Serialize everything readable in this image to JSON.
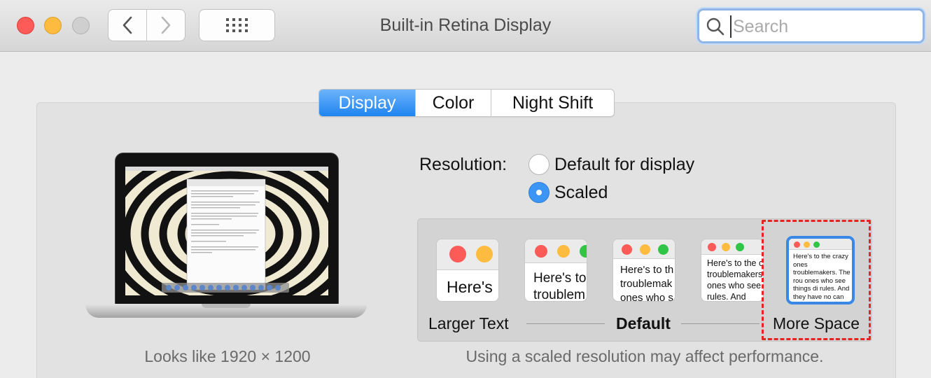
{
  "window": {
    "title": "Built-in Retina Display",
    "traffic_lights": [
      "close",
      "minimize",
      "zoom"
    ]
  },
  "toolbar": {
    "back_icon": "chevron-left-icon",
    "forward_icon": "chevron-right-icon",
    "show_all_icon": "grid-icon",
    "search": {
      "placeholder": "Search",
      "value": ""
    }
  },
  "tabs": [
    {
      "label": "Display",
      "selected": true
    },
    {
      "label": "Color",
      "selected": false
    },
    {
      "label": "Night Shift",
      "selected": false
    }
  ],
  "preview": {
    "looks_like": "Looks like 1920 × 1200"
  },
  "resolution": {
    "label": "Resolution:",
    "options": [
      {
        "label": "Default for display",
        "selected": false
      },
      {
        "label": "Scaled",
        "selected": true
      }
    ]
  },
  "scaled": {
    "sample_text": "Here's to the crazy ones troublemakers. The round ones who see things di rules. And they have no can quote them, disagr them. About the only th Because they change th",
    "thumbnails": [
      {
        "text": "Here's",
        "selected": false
      },
      {
        "text": "Here's to troublem",
        "selected": false
      },
      {
        "text": "Here's to th troublemak ones who s",
        "selected": false
      },
      {
        "text": "Here's to the c troublemakers ones who see rules. And they",
        "selected": false
      },
      {
        "text": "Here's to the crazy ones troublemakers. The rou ones who see things di rules. And they have no can quote them, disagr them. About the only th Because they change th",
        "selected": true
      }
    ],
    "labels": {
      "left": "Larger Text",
      "middle": "Default",
      "right": "More Space"
    },
    "note": "Using a scaled resolution may affect performance."
  },
  "colors": {
    "accent": "#1f84f0",
    "highlight": "#e8231f",
    "close": "#fc5b57",
    "minimize": "#fdbc40",
    "zoom": "#cfcfcf"
  }
}
